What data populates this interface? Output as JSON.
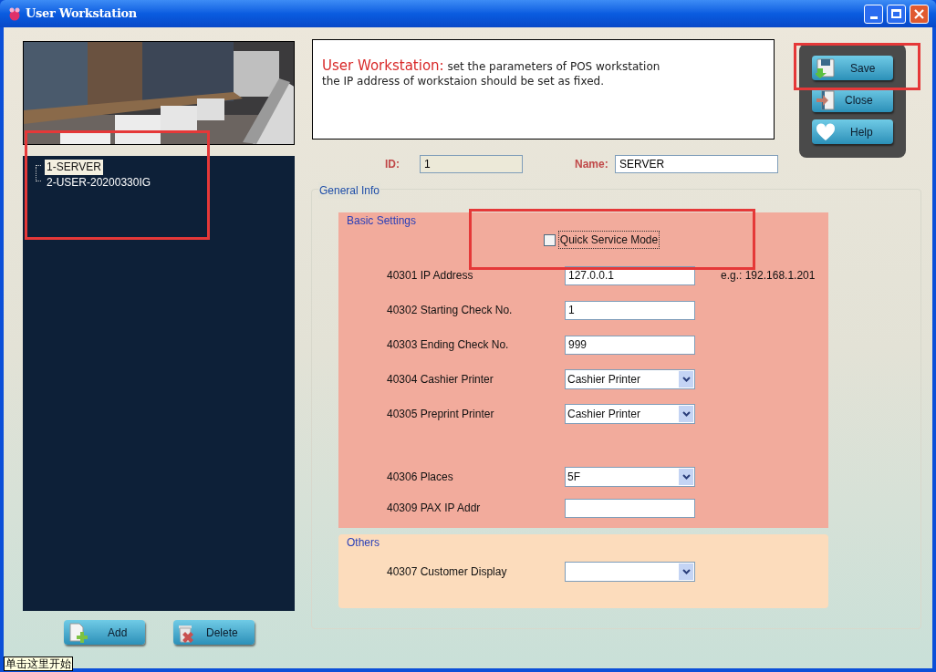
{
  "window": {
    "title": "User Workstation"
  },
  "tree": {
    "items": [
      {
        "label": "1-SERVER",
        "selected": true
      },
      {
        "label": "2-USER-20200330IG",
        "selected": false
      }
    ]
  },
  "list_buttons": [
    {
      "label": "Add",
      "kind": "add"
    },
    {
      "label": "Delete",
      "kind": "delete"
    }
  ],
  "description": {
    "heading": "User Workstation:",
    "lines": [
      "set the parameters of POS workstation",
      "the IP address of workstaion should be set as fixed."
    ]
  },
  "toolbar": [
    {
      "label": "Save",
      "kind": "save"
    },
    {
      "label": "Close",
      "kind": "close"
    },
    {
      "label": "Help",
      "kind": "help"
    }
  ],
  "id_field": {
    "label": "ID:",
    "value": "1"
  },
  "name_field": {
    "label": "Name:",
    "value": "SERVER"
  },
  "general_info": {
    "title": "General Info",
    "basic_settings": {
      "title": "Basic Settings",
      "quick_service_mode": {
        "label": "Quick Service Mode",
        "checked": false
      },
      "rows": [
        {
          "kind": "text",
          "label": "40301 IP Address",
          "value": "127.0.0.1",
          "hint": "e.g.: 192.168.1.201"
        },
        {
          "kind": "text",
          "label": "40302 Starting Check No.",
          "value": "1"
        },
        {
          "kind": "text",
          "label": "40303 Ending Check No.",
          "value": "999"
        },
        {
          "kind": "select",
          "label": "40304 Cashier Printer",
          "value": "Cashier Printer"
        },
        {
          "kind": "select",
          "label": "40305 Preprint Printer",
          "value": "Cashier Printer"
        }
      ],
      "place_rows": [
        {
          "kind": "select",
          "label": "40306 Places",
          "value": "5F"
        },
        {
          "kind": "text",
          "label": "40309 PAX IP Addr"
        }
      ]
    },
    "others": {
      "title": "Others",
      "rows": [
        {
          "kind": "select",
          "label": "40307 Customer Display"
        }
      ]
    }
  },
  "start_tooltip": "单击这里开始"
}
